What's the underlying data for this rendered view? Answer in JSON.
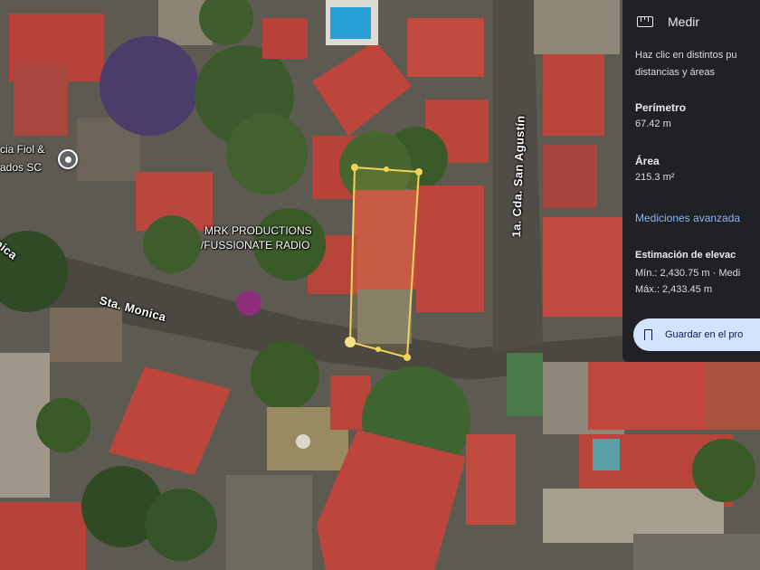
{
  "map": {
    "type": "satellite",
    "colors": {
      "roof_red": "#b8423a",
      "roof_tan": "#9a8f80",
      "tree_green": "#3a5a2a",
      "road": "#55524a",
      "measure_line": "#f2d45a"
    },
    "labels": {
      "street_sta_monica": "Sta. Monica",
      "street_sta_monica_left": "nica",
      "street_san_agustin": "1a. Cda. San Agustín",
      "poi_line1": "MRK PRODUCTIONS",
      "poi_line2": "/FUSSIONATE RADIO",
      "poi_left_line1": "cia Fiol &",
      "poi_left_line2": "ados SC"
    },
    "icons": {
      "poi_pin": "location-pin-icon"
    }
  },
  "panel": {
    "title": "Medir",
    "title_icon": "ruler-icon",
    "instruction_line1": "Haz clic en distintos pu",
    "instruction_line2": "distancias y áreas",
    "perimeter_label": "Perímetro",
    "perimeter_value": "67.42 m",
    "area_label": "Área",
    "area_value": "215.3 m²",
    "advanced_link": "Mediciones avanzada",
    "elevation_label": "Estimación de elevac",
    "elevation_min": "Mín.: 2,430.75 m · Medi",
    "elevation_max": "Máx.: 2,433.45 m",
    "save_button": "Guardar en el pro",
    "save_icon": "bookmark-icon"
  }
}
